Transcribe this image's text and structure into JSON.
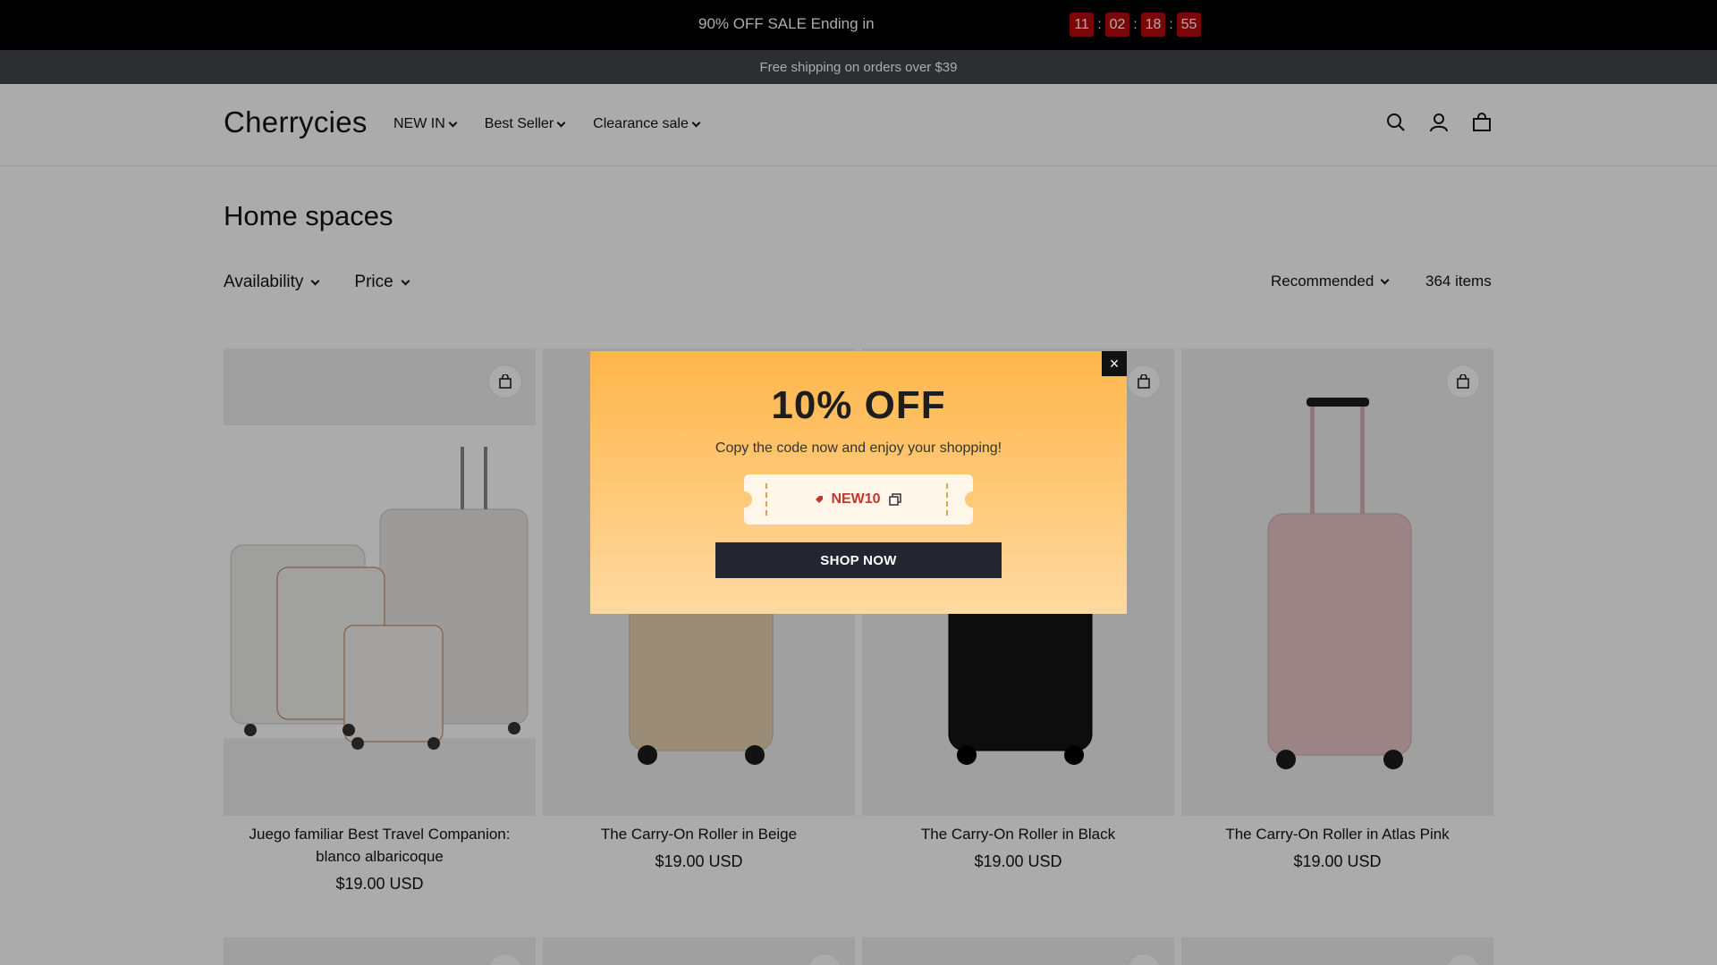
{
  "sale_bar": {
    "text": "90% OFF SALE Ending in",
    "countdown": [
      "11",
      "02",
      "18",
      "55"
    ]
  },
  "shipping": {
    "text": "Free shipping on orders over $39"
  },
  "header": {
    "logo": "Cherrycies",
    "nav": [
      {
        "label": "NEW IN"
      },
      {
        "label": "Best Seller"
      },
      {
        "label": "Clearance sale"
      }
    ],
    "icons": [
      "search-icon",
      "account-icon",
      "cart-icon"
    ]
  },
  "main": {
    "title": "Home spaces",
    "filters": [
      {
        "label": "Availability"
      },
      {
        "label": "Price"
      }
    ],
    "sort_label": "Recommended",
    "count": "364 items"
  },
  "products": [
    {
      "title": "Juego familiar Best Travel Companion: blanco albaricoque",
      "price": "$19.00 USD",
      "color": "#ecebe8"
    },
    {
      "title": "The Carry-On Roller in Beige",
      "price": "$19.00 USD",
      "color": "#e7d1b4"
    },
    {
      "title": "The Carry-On Roller in Black",
      "price": "$19.00 USD",
      "color": "#141414"
    },
    {
      "title": "The Carry-On Roller in Atlas Pink",
      "price": "$19.00 USD",
      "color": "#e7c4c8"
    }
  ],
  "popup": {
    "title": "10% OFF",
    "subtitle": "Copy the code now and enjoy your shopping!",
    "code": "NEW10",
    "button": "SHOP NOW",
    "close": "×"
  },
  "colors": {
    "sale_bar_bg": "#000000",
    "countdown_box": "#b8090d",
    "shipping_bg": "#42454a",
    "popup_gradient_top": "#ffb64a",
    "popup_gradient_bottom": "#ffd9a0",
    "button_bg": "#232631"
  }
}
